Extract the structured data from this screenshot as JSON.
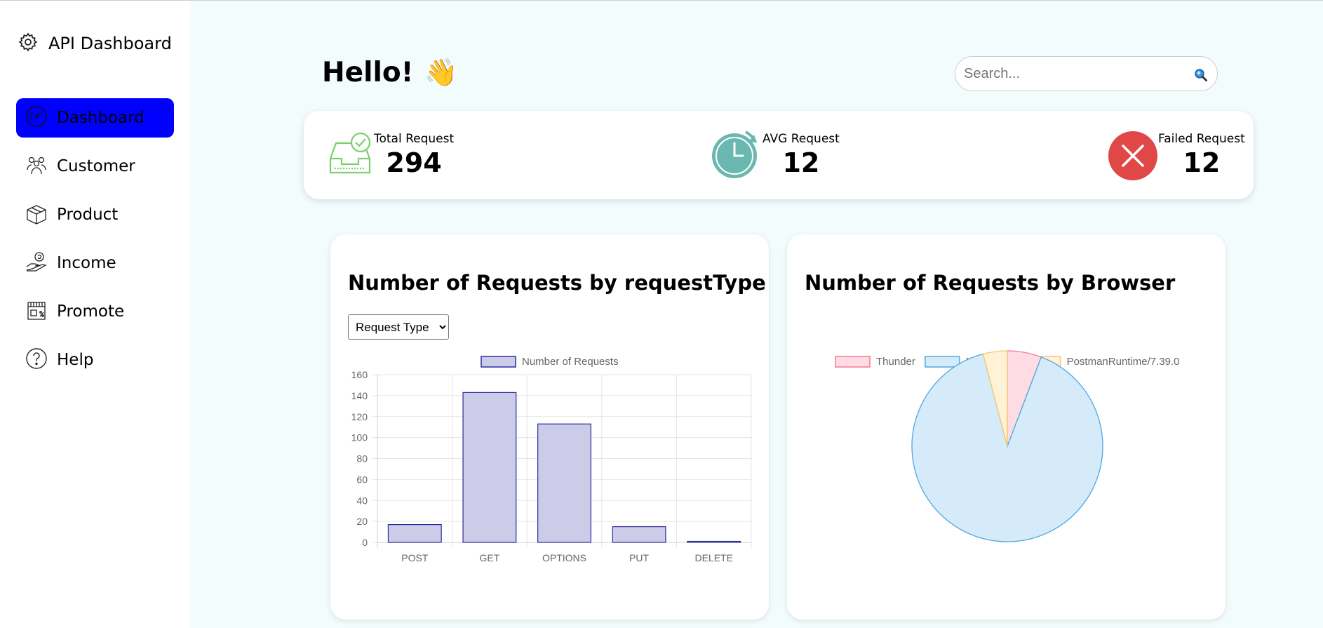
{
  "sidebar": {
    "brand": "API Dashboard",
    "items": [
      {
        "label": "Dashboard",
        "icon": "speedometer-icon",
        "active": true
      },
      {
        "label": "Customer",
        "icon": "users-icon",
        "active": false
      },
      {
        "label": "Product",
        "icon": "box-icon",
        "active": false
      },
      {
        "label": "Income",
        "icon": "hand-coin-icon",
        "active": false
      },
      {
        "label": "Promote",
        "icon": "store-icon",
        "active": false
      },
      {
        "label": "Help",
        "icon": "question-icon",
        "active": false
      }
    ]
  },
  "header": {
    "greeting": "Hello!",
    "wave": "👋",
    "search_placeholder": "Search..."
  },
  "stats": {
    "total": {
      "label": "Total Request",
      "value": "294"
    },
    "avg": {
      "label": "AVG Request",
      "value": "12"
    },
    "failed": {
      "label": "Failed Request",
      "value": "12"
    }
  },
  "charts": {
    "request_type_title": "Number of Requests by requestType",
    "select_value": "Request Type",
    "browser_title": "Number of Requests by Browser"
  },
  "colors": {
    "active_nav": "#0000ff",
    "bar_fill": "#cccce8",
    "bar_stroke": "#2b2ba0",
    "failed_red": "#e04848",
    "clock_teal": "#6bb8b0",
    "inbox_green": "#7ccf6a"
  },
  "chart_data": [
    {
      "type": "bar",
      "categories": [
        "POST",
        "GET",
        "OPTIONS",
        "PUT",
        "DELETE"
      ],
      "values": [
        17,
        143,
        113,
        15,
        1
      ],
      "series_name": "Number of Requests",
      "ylim": [
        0,
        160
      ],
      "yticks": [
        0,
        20,
        40,
        60,
        80,
        100,
        120,
        140,
        160
      ],
      "grid": true,
      "legend": "top"
    },
    {
      "type": "pie",
      "labels": [
        "Thunder",
        "Mozilla/5.0",
        "PostmanRuntime/7.39.0"
      ],
      "values": [
        17,
        265,
        12
      ],
      "colors": [
        "#ffdce3",
        "#d6ebf9",
        "#fff2d6"
      ],
      "strokes": [
        "#f27a93",
        "#4ea8e0",
        "#f5c869"
      ],
      "legend": "top"
    }
  ]
}
